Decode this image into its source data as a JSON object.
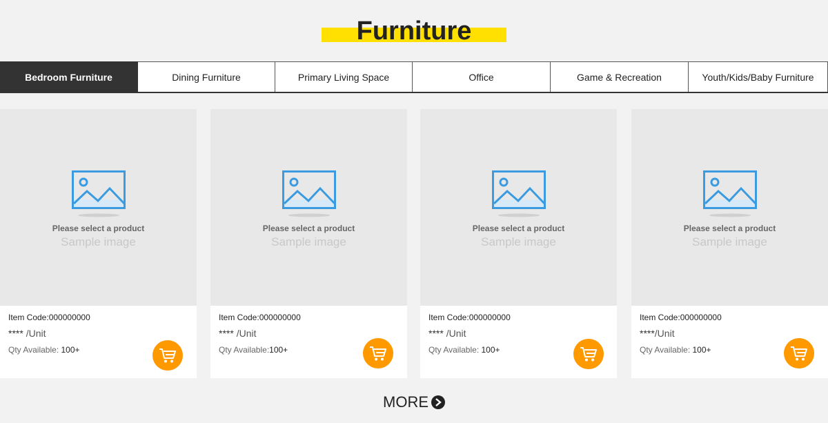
{
  "header": {
    "title": "Furniture",
    "accent_color": "#ffe000"
  },
  "tabs": [
    {
      "label": "Bedroom Furniture",
      "active": true
    },
    {
      "label": "Dining Furniture",
      "active": false
    },
    {
      "label": "Primary Living Space",
      "active": false
    },
    {
      "label": "Office",
      "active": false
    },
    {
      "label": "Game & Recreation",
      "active": false
    },
    {
      "label": "Youth/Kids/Baby Furniture",
      "active": false
    }
  ],
  "products": [
    {
      "placeholder_title": "Please select a product",
      "placeholder_sub": "Sample image",
      "item_code": "Item Code:000000000",
      "price": "****",
      "unit": "/Unit",
      "qty_label": "Qty Available:",
      "qty_value": "100+",
      "cart_icon": "cart-icon"
    },
    {
      "placeholder_title": "Please select a product",
      "placeholder_sub": "Sample image",
      "item_code": "Item Code:000000000",
      "price": "****",
      "unit": "/Unit",
      "qty_label": "Qty Available:",
      "qty_value": "100+",
      "cart_icon": "cart-icon"
    },
    {
      "placeholder_title": "Please select a product",
      "placeholder_sub": "Sample image",
      "item_code": "Item Code:000000000",
      "price": "****",
      "unit": "/Unit",
      "qty_label": "Qty Available:",
      "qty_value": "100+",
      "cart_icon": "cart-icon"
    },
    {
      "placeholder_title": "Please select a product",
      "placeholder_sub": "Sample image",
      "item_code": "Item Code:000000000",
      "price": "****",
      "unit": "/Unit",
      "qty_label": "Qty Available:",
      "qty_value": "100+",
      "cart_icon": "cart-icon"
    }
  ],
  "more": {
    "label": "MORE",
    "icon": "chevron-right-icon"
  },
  "colors": {
    "cart_button": "#ff9900",
    "active_tab": "#333333",
    "image_icon": "#3a9be0"
  }
}
